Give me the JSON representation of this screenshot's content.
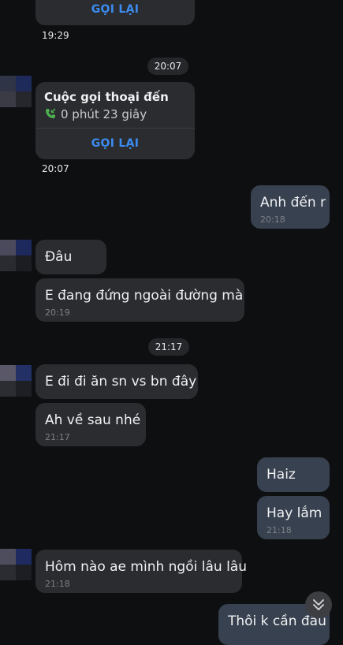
{
  "top_card": {
    "callback_label": "GỌI LẠI",
    "time": "19:29"
  },
  "time_separators": [
    "20:07",
    "21:17"
  ],
  "call_card": {
    "title": "Cuộc gọi thoại đến",
    "duration": "0 phút 23 giây",
    "callback_label": "GỌI LẠI",
    "time": "20:07"
  },
  "messages": [
    {
      "text": "Anh đến r",
      "time": "20:18",
      "direction": "outgoing"
    },
    {
      "text": "Đâu",
      "time": "",
      "direction": "incoming"
    },
    {
      "text": "E đang đứng ngoài đường mà",
      "time": "20:19",
      "direction": "incoming"
    },
    {
      "text": "E đi đi ăn sn vs bn đây",
      "time": "",
      "direction": "incoming"
    },
    {
      "text": "Ah về sau nhé",
      "time": "21:17",
      "direction": "incoming"
    },
    {
      "text": "Haiz",
      "time": "",
      "direction": "outgoing"
    },
    {
      "text": "Hay lắm",
      "time": "21:18",
      "direction": "outgoing"
    },
    {
      "text": "Hôm nào ae mình ngồi lâu lâu",
      "time": "21:18",
      "direction": "incoming"
    },
    {
      "text": "Thôi k cần đâu",
      "time": "",
      "direction": "outgoing"
    }
  ],
  "icons": {
    "incoming_call": "phone-incoming-icon",
    "scroll_down": "chevron-double-down-icon",
    "avatar": "pixelated-avatar"
  },
  "colors": {
    "background": "#0e0f11",
    "incoming_bubble": "#2b2c2f",
    "outgoing_bubble": "#38414f",
    "accent": "#3b8cf0",
    "call_icon": "#4caf50"
  }
}
